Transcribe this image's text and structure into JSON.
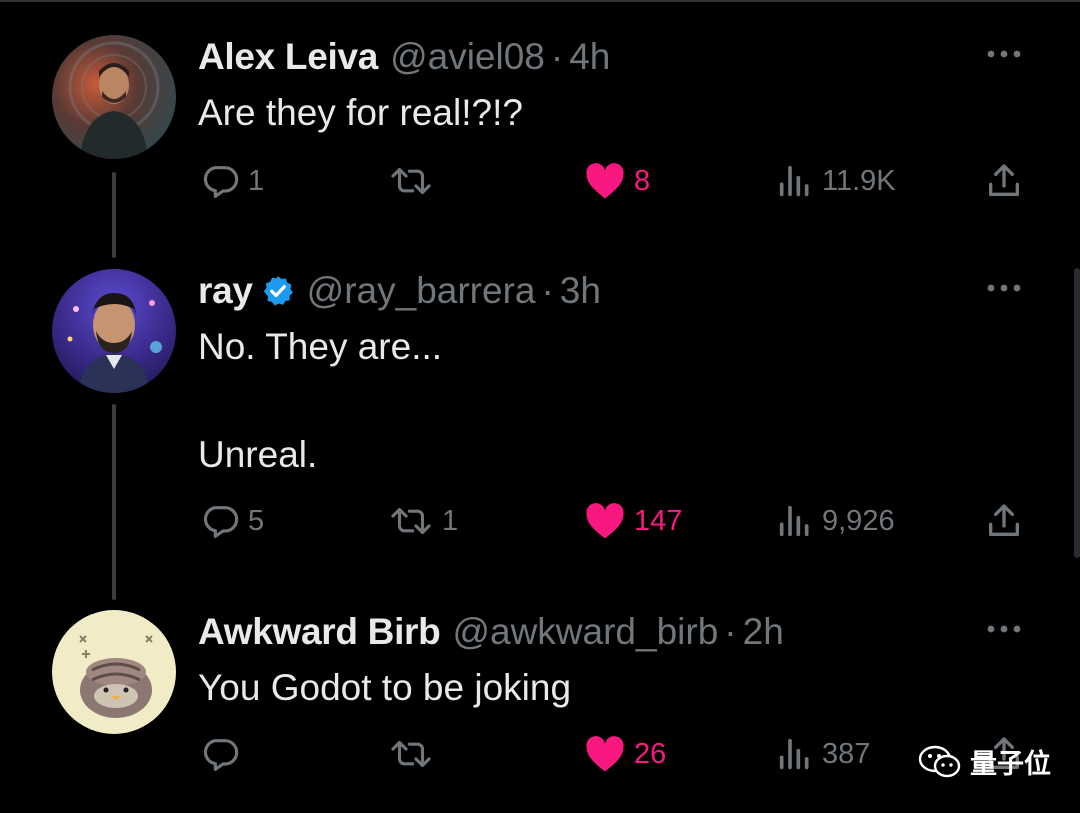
{
  "tweets": [
    {
      "name": "Alex Leiva",
      "handle": "@aviel08",
      "sep": "·",
      "time": "4h",
      "verified": false,
      "text": "Are they for real!?!?",
      "replies": "1",
      "retweets": "",
      "likes": "8",
      "views": "11.9K",
      "liked": true
    },
    {
      "name": "ray",
      "handle": "@ray_barrera",
      "sep": "·",
      "time": "3h",
      "verified": true,
      "text": "No. They are...\n\nUnreal.",
      "replies": "5",
      "retweets": "1",
      "likes": "147",
      "views": "9,926",
      "liked": true
    },
    {
      "name": "Awkward Birb",
      "handle": "@awkward_birb",
      "sep": "·",
      "time": "2h",
      "verified": false,
      "text": "You Godot to be joking",
      "replies": "",
      "retweets": "",
      "likes": "26",
      "views": "387",
      "liked": true
    }
  ],
  "watermark": {
    "text": "量子位"
  },
  "colors": {
    "background": "#000000",
    "text": "#e7e9ea",
    "muted": "#71767b",
    "like": "#f91880",
    "verified": "#1d9bf0"
  }
}
